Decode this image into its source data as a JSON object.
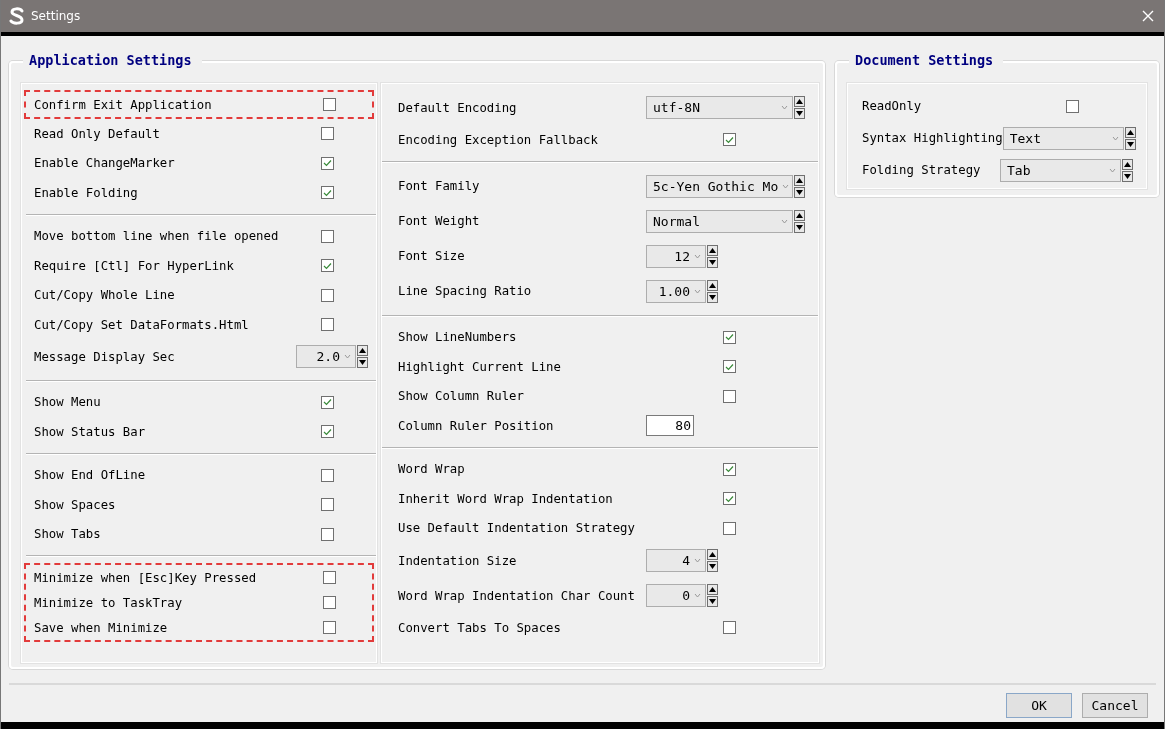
{
  "window": {
    "title": "Settings"
  },
  "application_settings": {
    "title": "Application Settings",
    "columns": [
      [
        {
          "rows": [
            {
              "label": "Confirm Exit Application",
              "kind": "checkbox",
              "checked": false,
              "highlighted": true
            },
            {
              "label": "Read Only Default",
              "kind": "checkbox",
              "checked": false,
              "highlighted": false
            },
            {
              "label": "Enable ChangeMarker",
              "kind": "checkbox",
              "checked": true,
              "highlighted": false
            },
            {
              "label": "Enable Folding",
              "kind": "checkbox",
              "checked": true,
              "highlighted": false
            }
          ]
        },
        {
          "rows": [
            {
              "label": "Move bottom line when file opened",
              "kind": "checkbox",
              "checked": false,
              "highlighted": false
            },
            {
              "label": "Require [Ctl] For HyperLink",
              "kind": "checkbox",
              "checked": true,
              "highlighted": false
            },
            {
              "label": "Cut/Copy Whole Line",
              "kind": "checkbox",
              "checked": false,
              "highlighted": false
            },
            {
              "label": "Cut/Copy Set DataFormats.Html",
              "kind": "checkbox",
              "checked": false,
              "highlighted": false
            },
            {
              "label": "Message Display Sec",
              "kind": "number",
              "value": "2.0",
              "highlighted": false
            }
          ]
        },
        {
          "rows": [
            {
              "label": "Show Menu",
              "kind": "checkbox",
              "checked": true,
              "highlighted": false
            },
            {
              "label": "Show Status Bar",
              "kind": "checkbox",
              "checked": true,
              "highlighted": false
            }
          ]
        },
        {
          "rows": [
            {
              "label": "Show End OfLine",
              "kind": "checkbox",
              "checked": false,
              "highlighted": false
            },
            {
              "label": "Show Spaces",
              "kind": "checkbox",
              "checked": false,
              "highlighted": false
            },
            {
              "label": "Show Tabs",
              "kind": "checkbox",
              "checked": false,
              "highlighted": false
            }
          ]
        },
        {
          "rows": [
            {
              "label": "Minimize when [Esc]Key Pressed",
              "kind": "checkbox",
              "checked": false,
              "highlighted": true
            },
            {
              "label": "Minimize to TaskTray",
              "kind": "checkbox",
              "checked": false,
              "highlighted": true
            },
            {
              "label": "Save when Minimize",
              "kind": "checkbox",
              "checked": false,
              "highlighted": true
            }
          ]
        }
      ],
      [
        {
          "rows": [
            {
              "label": "Default Encoding",
              "kind": "select",
              "value": "utf-8N",
              "highlighted": false
            },
            {
              "label": "Encoding Exception Fallback",
              "kind": "checkbox",
              "checked": true,
              "highlighted": false
            }
          ]
        },
        {
          "rows": [
            {
              "label": "Font Family",
              "kind": "select",
              "value": "5c-Yen Gothic Mo",
              "highlighted": false
            },
            {
              "label": "Font Weight",
              "kind": "select",
              "value": "Normal",
              "highlighted": false
            },
            {
              "label": "Font Size",
              "kind": "number",
              "value": "12",
              "highlighted": false
            },
            {
              "label": "Line Spacing Ratio",
              "kind": "number",
              "value": "1.00",
              "highlighted": false
            }
          ]
        },
        {
          "rows": [
            {
              "label": "Show LineNumbers",
              "kind": "checkbox",
              "checked": true,
              "highlighted": false
            },
            {
              "label": "Highlight Current Line",
              "kind": "checkbox",
              "checked": true,
              "highlighted": false
            },
            {
              "label": "Show Column Ruler",
              "kind": "checkbox",
              "checked": false,
              "highlighted": false
            },
            {
              "label": "Column Ruler Position",
              "kind": "textbox",
              "value": "80",
              "highlighted": false
            }
          ]
        },
        {
          "rows": [
            {
              "label": "Word Wrap",
              "kind": "checkbox",
              "checked": true,
              "highlighted": false
            },
            {
              "label": "Inherit Word Wrap Indentation",
              "kind": "checkbox",
              "checked": true,
              "highlighted": false
            },
            {
              "label": "Use Default Indentation Strategy",
              "kind": "checkbox",
              "checked": false,
              "highlighted": false
            },
            {
              "label": "Indentation Size",
              "kind": "number",
              "value": "4",
              "highlighted": false
            },
            {
              "label": "Word Wrap Indentation Char Count",
              "kind": "number",
              "value": "0",
              "highlighted": false
            },
            {
              "label": "Convert Tabs To Spaces",
              "kind": "checkbox",
              "checked": false,
              "highlighted": false
            }
          ]
        }
      ]
    ]
  },
  "document_settings": {
    "title": "Document Settings",
    "rows": [
      {
        "label": "ReadOnly",
        "kind": "checkbox",
        "checked": false
      },
      {
        "label": "Syntax Highlighting",
        "kind": "select",
        "value": "Text"
      },
      {
        "label": "Folding Strategy",
        "kind": "select",
        "value": "Tab"
      }
    ]
  },
  "buttons": [
    {
      "label": "OK"
    },
    {
      "label": "Cancel"
    }
  ]
}
